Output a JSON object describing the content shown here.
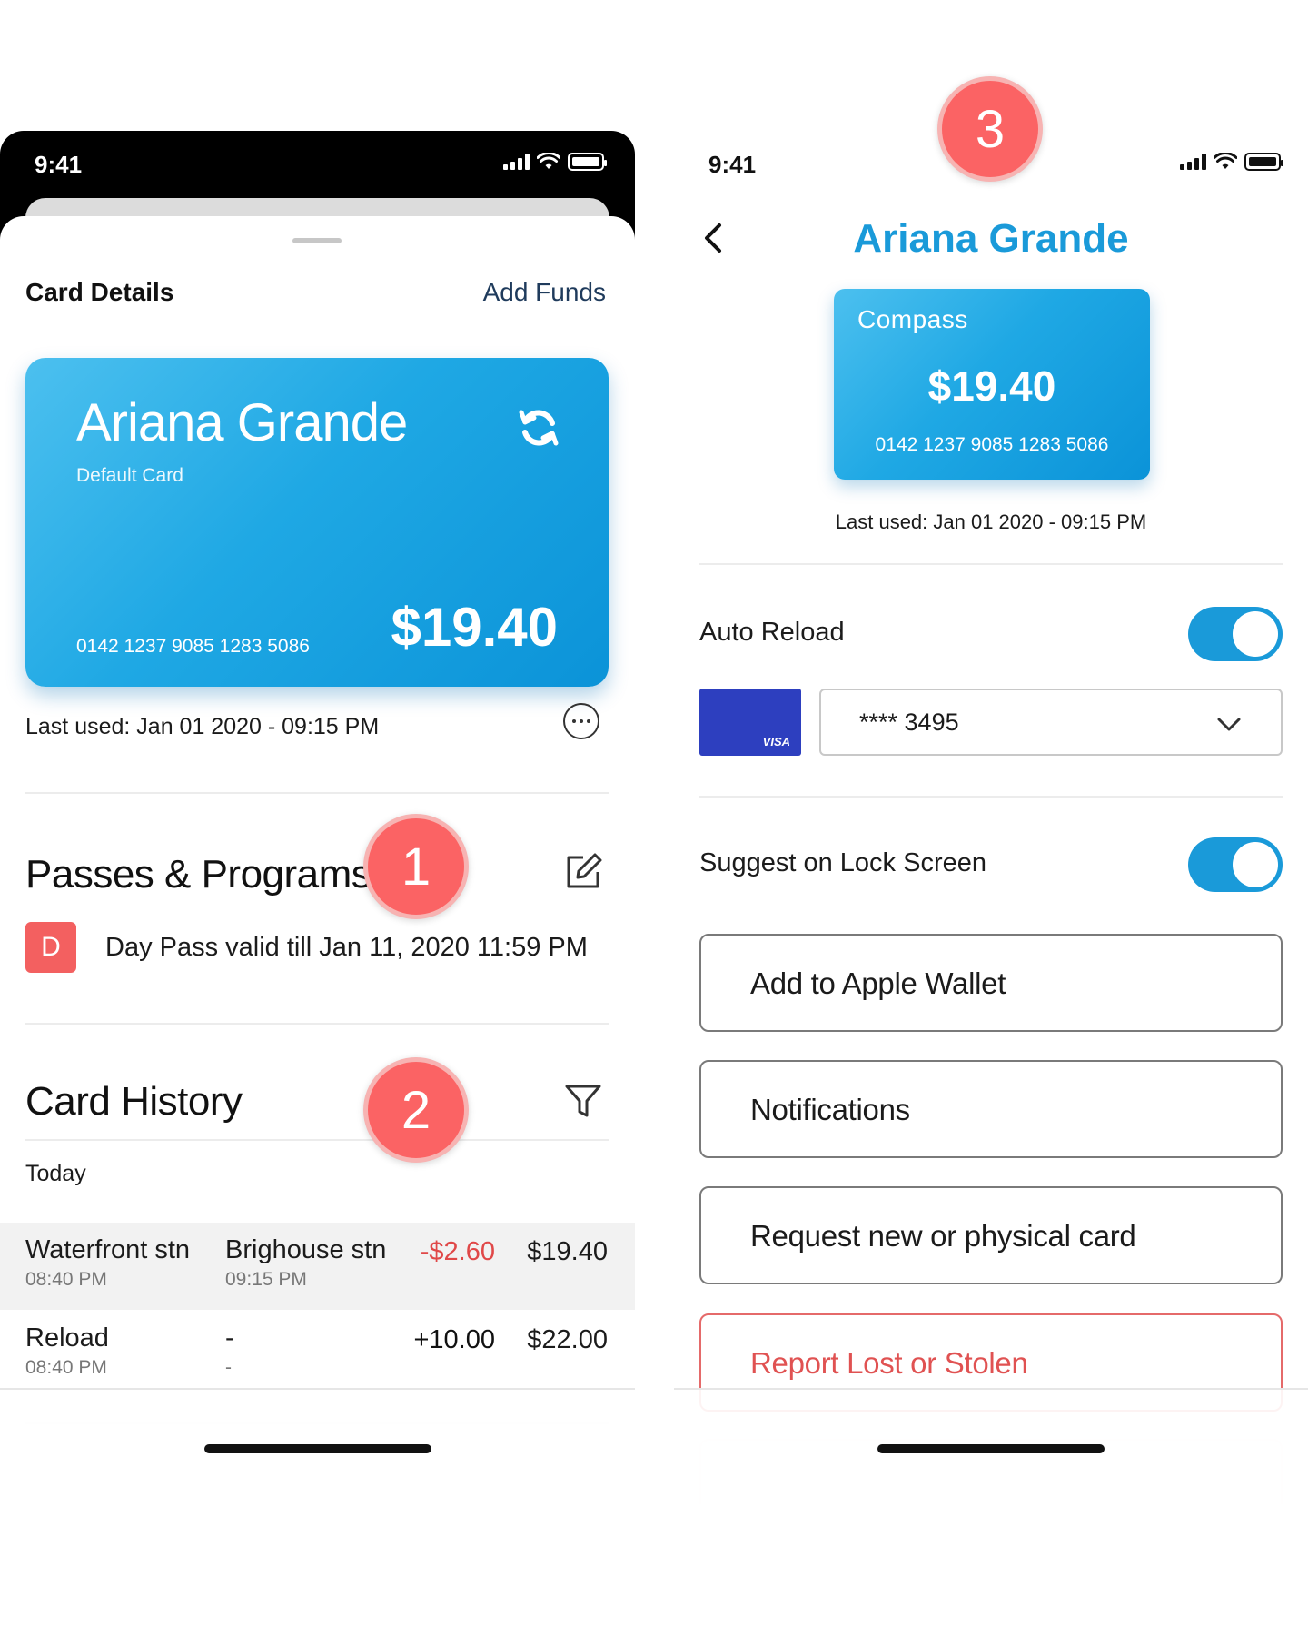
{
  "left": {
    "status": {
      "time": "9:41"
    },
    "sheet": {
      "title": "Card Details",
      "add_funds": "Add Funds"
    },
    "card": {
      "name": "Ariana Grande",
      "subtitle": "Default Card",
      "number": "0142 1237 9085 1283 5086",
      "balance": "$19.40"
    },
    "last_used": "Last used: Jan 01 2020 - 09:15 PM",
    "passes": {
      "title": "Passes & Programs",
      "items": [
        {
          "badge": "D",
          "text": "Day Pass valid till Jan 11, 2020 11:59 PM"
        }
      ]
    },
    "history": {
      "title": "Card History",
      "group_label": "Today",
      "rows": [
        {
          "from": "Waterfront stn",
          "from_time": "08:40 PM",
          "to": "Brighouse stn",
          "to_time": "09:15 PM",
          "amount": "-$2.60",
          "balance": "$19.40"
        },
        {
          "from": "Reload",
          "from_time": "08:40 PM",
          "to": "-",
          "to_time": "-",
          "amount": "+10.00",
          "balance": "$22.00"
        }
      ]
    }
  },
  "right": {
    "status": {
      "time": "9:41"
    },
    "title": "Ariana Grande",
    "card": {
      "logo": "Compass",
      "balance": "$19.40",
      "number": "0142 1237 9085 1283 5086"
    },
    "last_used": "Last used: Jan 01 2020 - 09:15 PM",
    "auto_reload": {
      "label": "Auto Reload",
      "on": true
    },
    "payment": {
      "brand": "VISA",
      "selected": "**** 3495"
    },
    "suggest_lock": {
      "label": "Suggest on Lock Screen",
      "on": true
    },
    "actions": {
      "apple_wallet": "Add to Apple Wallet",
      "notifications": "Notifications",
      "request_card": "Request new or physical card",
      "report_lost": "Report Lost or Stolen"
    }
  },
  "markers": [
    "1",
    "2",
    "3"
  ],
  "colors": {
    "accent": "#1a9ad9",
    "danger": "#e05252",
    "marker": "#fb6364",
    "visa": "#2d3fbf"
  }
}
